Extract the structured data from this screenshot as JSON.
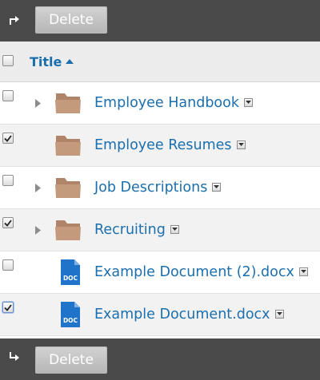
{
  "toolbar_top": {
    "arrow_icon": "arrow-turn-right-icon",
    "delete_label": "Delete"
  },
  "toolbar_bottom": {
    "arrow_icon": "arrow-turn-down-right-icon",
    "delete_label": "Delete"
  },
  "header": {
    "title_label": "Title",
    "sort_icon": "sort-ascending-icon",
    "select_all_checked": false
  },
  "items": [
    {
      "type": "folder",
      "label": "Employee Handbook",
      "checked": false,
      "expandable": true
    },
    {
      "type": "folder",
      "label": "Employee Resumes",
      "checked": true,
      "expandable": false
    },
    {
      "type": "folder",
      "label": "Job Descriptions",
      "checked": false,
      "expandable": true
    },
    {
      "type": "folder",
      "label": "Recruiting",
      "checked": true,
      "expandable": true
    },
    {
      "type": "document",
      "label": "Example Document (2).docx",
      "checked": false,
      "expandable": false,
      "badge": "DOC"
    },
    {
      "type": "document",
      "label": "Example Document.docx",
      "checked": true,
      "expandable": false,
      "badge": "DOC"
    }
  ],
  "colors": {
    "toolbar_bg": "#4a4a4a",
    "link": "#1b6fae",
    "folder": "#c49a7c",
    "doc": "#1f73c8"
  }
}
